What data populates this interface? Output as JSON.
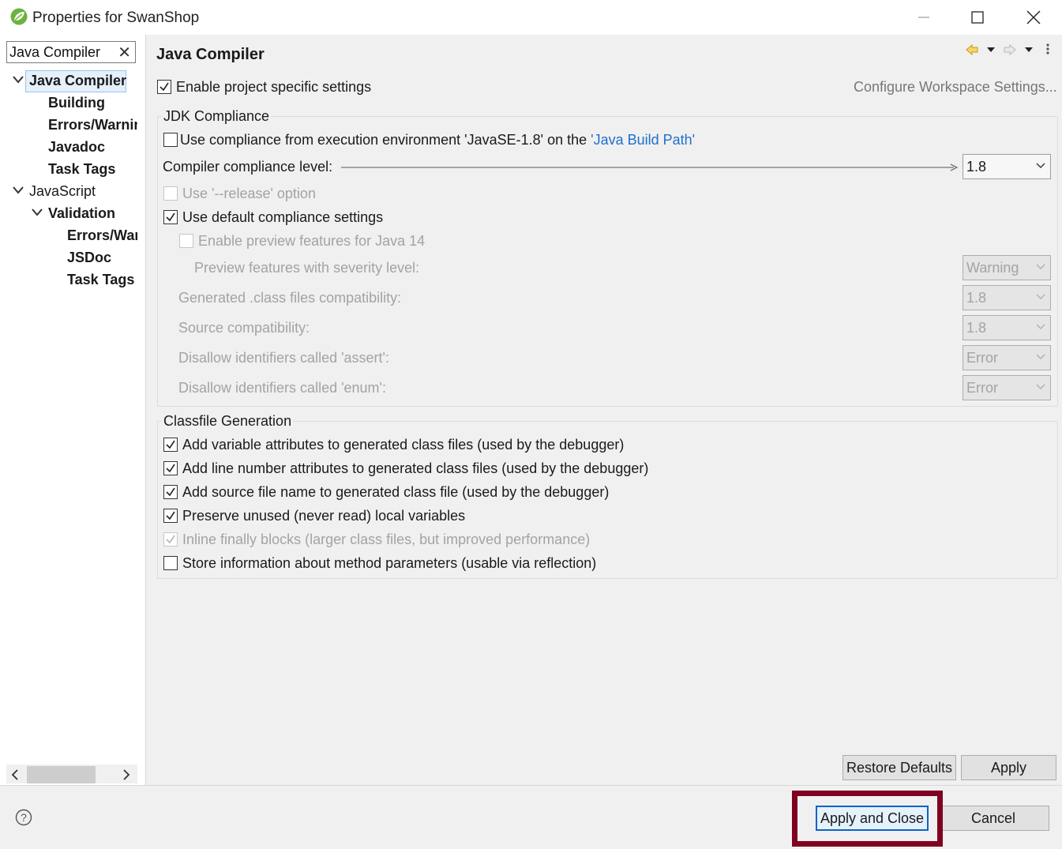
{
  "window": {
    "title": "Properties for SwanShop"
  },
  "nav": {
    "filter_value": "Java Compiler",
    "items": [
      {
        "label": "Java Compiler",
        "expanded": true
      },
      {
        "label": "Building"
      },
      {
        "label": "Errors/Warnings"
      },
      {
        "label": "Javadoc"
      },
      {
        "label": "Task Tags"
      },
      {
        "label": "JavaScript",
        "expanded": true
      },
      {
        "label": "Validation",
        "expanded": true
      },
      {
        "label": "Errors/Warnings"
      },
      {
        "label": "JSDoc"
      },
      {
        "label": "Task Tags"
      }
    ]
  },
  "page": {
    "title": "Java Compiler",
    "enable_specific": "Enable project specific settings",
    "configure_workspace": "Configure Workspace Settings...",
    "jdk": {
      "group_title": "JDK Compliance",
      "use_env_prefix": "Use compliance from execution environment 'JavaSE-1.8' on the ",
      "use_env_link": "'Java Build Path'",
      "compliance_label": "Compiler compliance level:",
      "compliance_value": "1.8",
      "release_option": "Use '--release' option",
      "default_settings": "Use default compliance settings",
      "preview_features": "Enable preview features for Java 14",
      "preview_severity_label": "Preview features with severity level:",
      "preview_severity_value": "Warning",
      "class_compat_label": "Generated .class files compatibility:",
      "class_compat_value": "1.8",
      "source_compat_label": "Source compatibility:",
      "source_compat_value": "1.8",
      "assert_label": "Disallow identifiers called 'assert':",
      "assert_value": "Error",
      "enum_label": "Disallow identifiers called 'enum':",
      "enum_value": "Error"
    },
    "classfile": {
      "group_title": "Classfile Generation",
      "options": [
        {
          "label": "Add variable attributes to generated class files (used by the debugger)",
          "checked": true,
          "enabled": true
        },
        {
          "label": "Add line number attributes to generated class files (used by the debugger)",
          "checked": true,
          "enabled": true
        },
        {
          "label": "Add source file name to generated class file (used by the debugger)",
          "checked": true,
          "enabled": true
        },
        {
          "label": "Preserve unused (never read) local variables",
          "checked": true,
          "enabled": true
        },
        {
          "label": "Inline finally blocks (larger class files, but improved performance)",
          "checked": true,
          "enabled": false
        },
        {
          "label": "Store information about method parameters (usable via reflection)",
          "checked": false,
          "enabled": true
        }
      ]
    },
    "restore_defaults": "Restore Defaults",
    "apply": "Apply"
  },
  "footer": {
    "apply_close": "Apply and Close",
    "cancel": "Cancel"
  },
  "colors": {
    "highlight_border": "#800020",
    "link": "#1f6fcc"
  }
}
